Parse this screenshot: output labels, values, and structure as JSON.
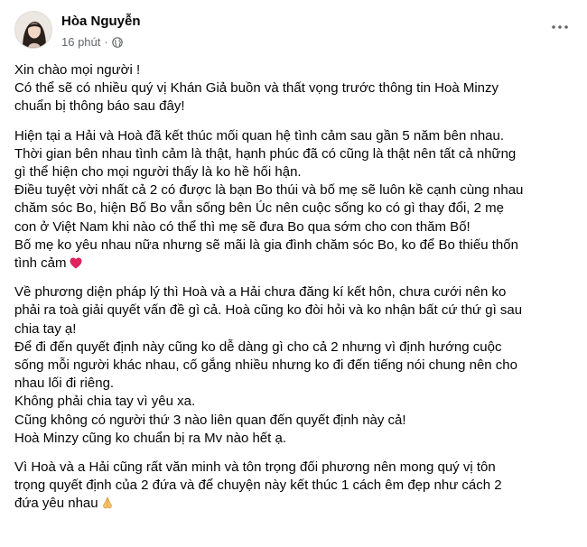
{
  "post": {
    "author": "Hòa Nguyễn",
    "time": "16 phút",
    "dot": "·",
    "privacy_icon": "globe-icon",
    "more_icon": "more-options-icon"
  },
  "paragraphs": [
    [
      "Xin chào mọi người !",
      "Có thể sẽ có nhiều quý vị Khán Giả buồn và thất vọng trước thông tin Hoà Minzy",
      "chuẩn bị thông báo sau đây!"
    ],
    [
      "Hiện tại a Hải và Hoà đã kết thúc mối quan hệ tình cảm sau gần 5 năm bên nhau.",
      "Thời gian bên nhau tình cảm là thật, hạnh phúc đã có cũng là thật nên tất cả những",
      "gì thể hiện cho mọi người thấy là ko hề hối hận.",
      "Điều tuyệt vời nhất cả 2 có được là bạn Bo thúi và bố mẹ sẽ luôn kề cạnh cùng nhau",
      "chăm sóc Bo, hiện Bố Bo vẫn sống bên Úc nên cuộc sống ko có gì thay đổi, 2 mẹ",
      "con ở Việt Nam khi nào có thể thì mẹ sẽ đưa Bo qua sớm cho con thăm Bố!",
      "Bố mẹ ko yêu nhau nữa nhưng sẽ mãi là gia đình chăm sóc Bo, ko để Bo thiếu thốn",
      "tình cảm"
    ],
    [
      "Về phương diện pháp lý thì Hoà và a Hải chưa đăng kí kết hôn, chưa cưới nên ko",
      "phải ra toà giải quyết vấn đề gì cả. Hoà cũng ko đòi hỏi và ko nhận bất cứ thứ gì sau",
      "chia tay ạ!",
      "Để đi đến quyết định này cũng ko dễ dàng gì cho cả 2 nhưng vì định hướng cuộc",
      "sống mỗi người khác nhau, cố gắng nhiều nhưng ko đi đến tiếng nói chung nên cho",
      "nhau lối đi riêng.",
      "Không phải chia tay vì yêu xa.",
      "Cũng không có người thứ 3 nào liên quan đến quyết định này cả!",
      "Hoà Minzy cũng ko chuẩn bị ra Mv nào hết ạ."
    ],
    [
      "Vì Hoà và a Hải cũng rất văn minh và tôn trọng đối phương nên mong quý vị tôn",
      "trọng quyết định của 2 đứa và để chuyện này kết thúc 1 cách êm đẹp như cách 2",
      "đứa yêu nhau"
    ]
  ],
  "emoji": {
    "heart": "red-heart-emoji",
    "pray": "folded-hands-emoji"
  },
  "colors": {
    "text": "#050505",
    "meta": "#65676b",
    "heart": "#e0245e"
  }
}
